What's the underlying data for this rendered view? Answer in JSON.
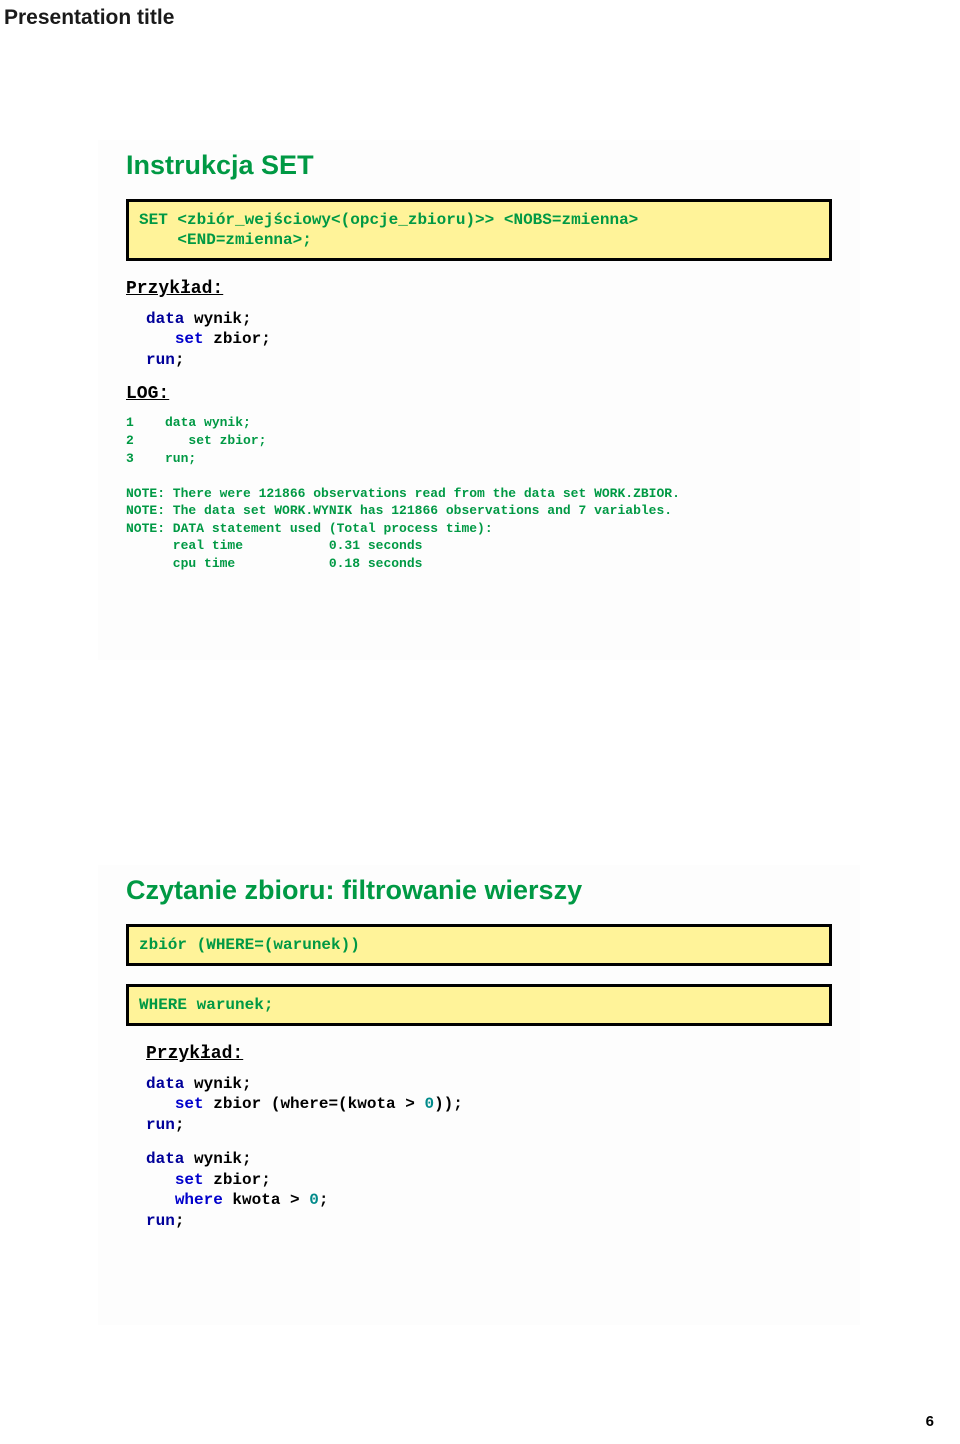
{
  "header": {
    "title": "Presentation title"
  },
  "page_number": "6",
  "slide1": {
    "title": "Instrukcja SET",
    "syntax_line1": "SET <zbiór_wejściowy<(opcje_zbioru)>> <NOBS=zmienna>",
    "syntax_line2": "    <END=zmienna>;",
    "example_label": "Przykład:",
    "code": {
      "kw_data": "data",
      "id_wynik": " wynik;",
      "indent": "   ",
      "kw_set": "set",
      "id_zbior": " zbior;",
      "kw_run": "run",
      "semi": ";"
    },
    "log_label": "LOG:",
    "log_text": "1    data wynik;\n2       set zbior;\n3    run;\n\nNOTE: There were 121866 observations read from the data set WORK.ZBIOR.\nNOTE: The data set WORK.WYNIK has 121866 observations and 7 variables.\nNOTE: DATA statement used (Total process time):\n      real time           0.31 seconds\n      cpu time            0.18 seconds"
  },
  "slide2": {
    "title": "Czytanie zbioru: filtrowanie wierszy",
    "syntax_box1": "zbiór (WHERE=(warunek))",
    "syntax_box2": "WHERE warunek;",
    "example_label": "Przykład:",
    "code_a": {
      "kw_data": "data",
      "id_wynik": " wynik;",
      "indent": "   ",
      "kw_set": "set",
      "id_zbior_where": " zbior (where=(kwota > ",
      "num_zero": "0",
      "close": "));",
      "kw_run": "run",
      "semi": ";"
    },
    "code_b": {
      "kw_data": "data",
      "id_wynik": " wynik;",
      "indent": "   ",
      "kw_set": "set",
      "id_zbior": " zbior;",
      "kw_where": "where",
      "id_kwota": " kwota > ",
      "num_zero": "0",
      "semi2": ";",
      "kw_run": "run",
      "semi": ";"
    }
  }
}
